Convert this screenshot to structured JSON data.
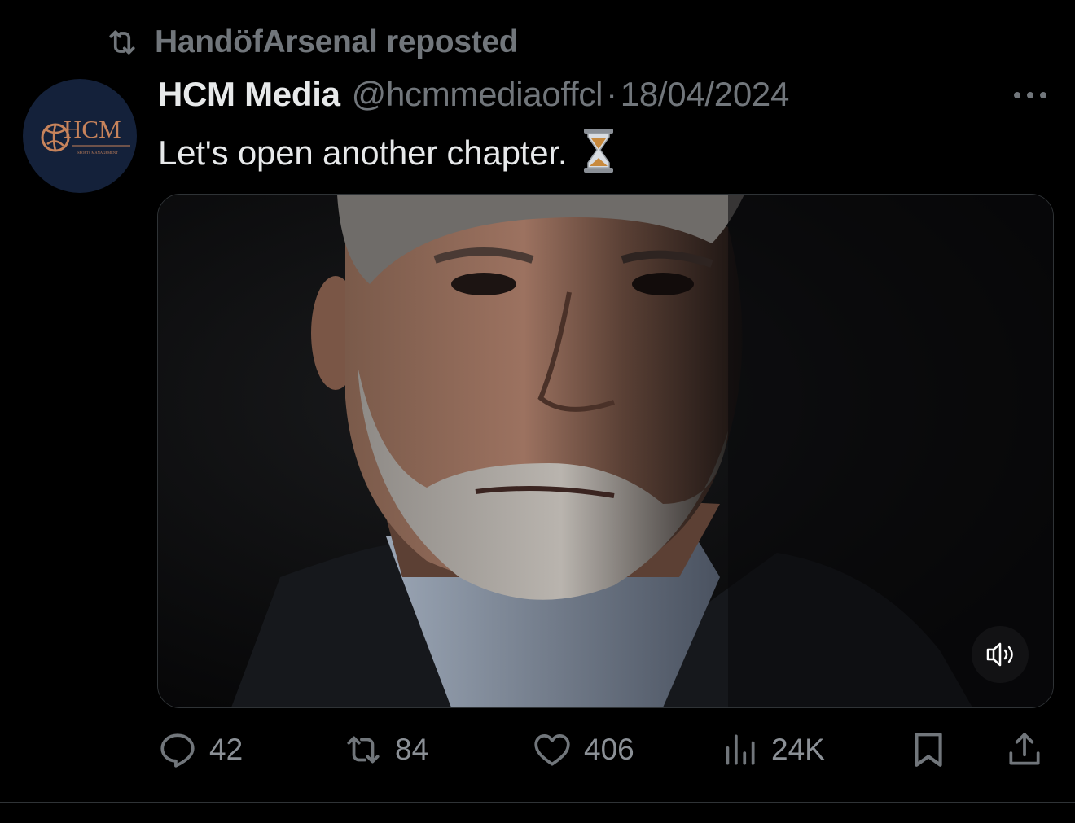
{
  "repost": {
    "text": "HandöfArsenal reposted",
    "icon": "repost-icon"
  },
  "author": {
    "display_name": "HCM Media",
    "handle": "@hcmmediaoffcl",
    "separator": "·",
    "date": "18/04/2024",
    "avatar_label": "HCM",
    "avatar_subtitle": "SPORTS MANAGEMENT",
    "avatar_bg": "#14213a",
    "avatar_accent": "#c7835b"
  },
  "tweet": {
    "text": "Let's open another chapter.",
    "emoji": "hourglass-icon"
  },
  "media": {
    "type": "video",
    "mute_icon": "speaker-muted-icon"
  },
  "actions": {
    "reply_count": "42",
    "repost_count": "84",
    "like_count": "406",
    "views_count": "24K"
  },
  "colors": {
    "background": "#000000",
    "text_primary": "#e7e9ea",
    "text_secondary": "#71767b",
    "divider": "#2f3336"
  }
}
